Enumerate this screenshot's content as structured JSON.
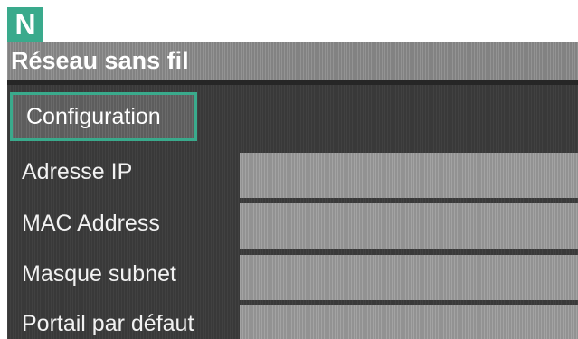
{
  "badge": {
    "letter": "N"
  },
  "window": {
    "title": "Réseau sans fil"
  },
  "config_button": {
    "label": "Configuration"
  },
  "rows": [
    {
      "label": "Adresse IP",
      "value": ""
    },
    {
      "label": "MAC Address",
      "value": ""
    },
    {
      "label": "Masque subnet",
      "value": ""
    },
    {
      "label": "Portail par défaut",
      "value": ""
    }
  ],
  "colors": {
    "accent": "#3aaa8c",
    "screen_bg": "#3b3b3b",
    "titlebar_bg": "#8a8a8a",
    "field_bg": "#9a9a9a"
  }
}
